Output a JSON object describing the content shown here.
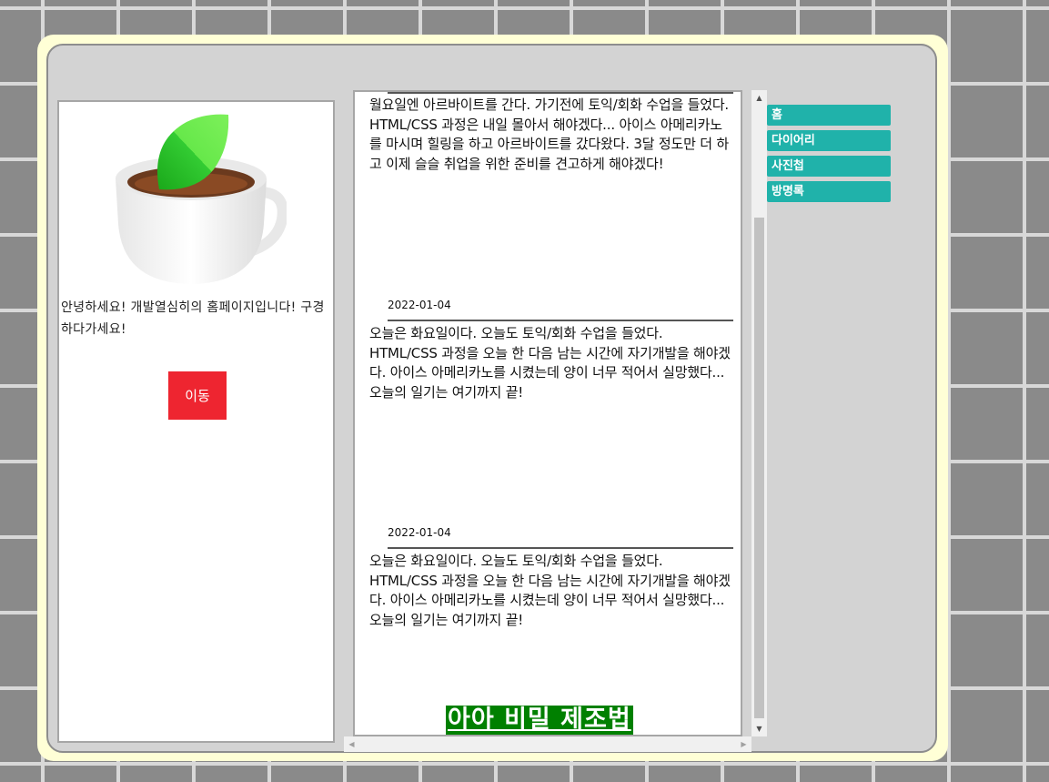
{
  "profile": {
    "greeting": "안녕하세요! 개발열심히의 홈페이지입니다! 구경하다가세요!",
    "button_label": "이동"
  },
  "diary": {
    "entries": [
      {
        "date": "",
        "text": "월요일엔 아르바이트를 간다. 가기전에 토익/회화 수업을 들었다. HTML/CSS 과정은 내일 몰아서 해야겠다... 아이스 아메리카노를 마시며 힐링을 하고 아르바이트를 갔다왔다. 3달 정도만 더 하고 이제 슬슬 취업을 위한 준비를 견고하게 해야겠다!"
      },
      {
        "date": "2022-01-04",
        "text": "오늘은 화요일이다. 오늘도 토익/회화 수업을 들었다. HTML/CSS 과정을 오늘 한 다음 남는 시간에 자기개발을 해야겠다. 아이스 아메리카노를 시켰는데 양이 너무 적어서 실망했다... 오늘의 일기는 여기까지 끝!"
      },
      {
        "date": "2022-01-04",
        "text": "오늘은 화요일이다. 오늘도 토익/회화 수업을 들었다. HTML/CSS 과정을 오늘 한 다음 남는 시간에 자기개발을 해야겠다. 아이스 아메리카노를 시켰는데 양이 너무 적어서 실망했다... 오늘의 일기는 여기까지 끝!"
      }
    ],
    "secret_link": "아아 비밀 제조법"
  },
  "nav": {
    "items": [
      "홈",
      "다이어리",
      "사진첩",
      "방명록"
    ]
  },
  "colors": {
    "nav_bg": "#20b2aa",
    "button_bg": "#ee2530",
    "secret_bg": "#008000"
  }
}
